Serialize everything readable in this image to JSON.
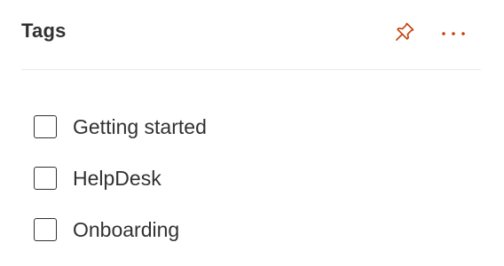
{
  "panel": {
    "title": "Tags",
    "accent_color": "#c2410c",
    "actions": [
      {
        "name": "pin",
        "icon": "pin-icon"
      },
      {
        "name": "more",
        "icon": "more-horizontal-icon"
      }
    ]
  },
  "tags": [
    {
      "label": "Getting started",
      "checked": false
    },
    {
      "label": "HelpDesk",
      "checked": false
    },
    {
      "label": "Onboarding",
      "checked": false
    }
  ]
}
